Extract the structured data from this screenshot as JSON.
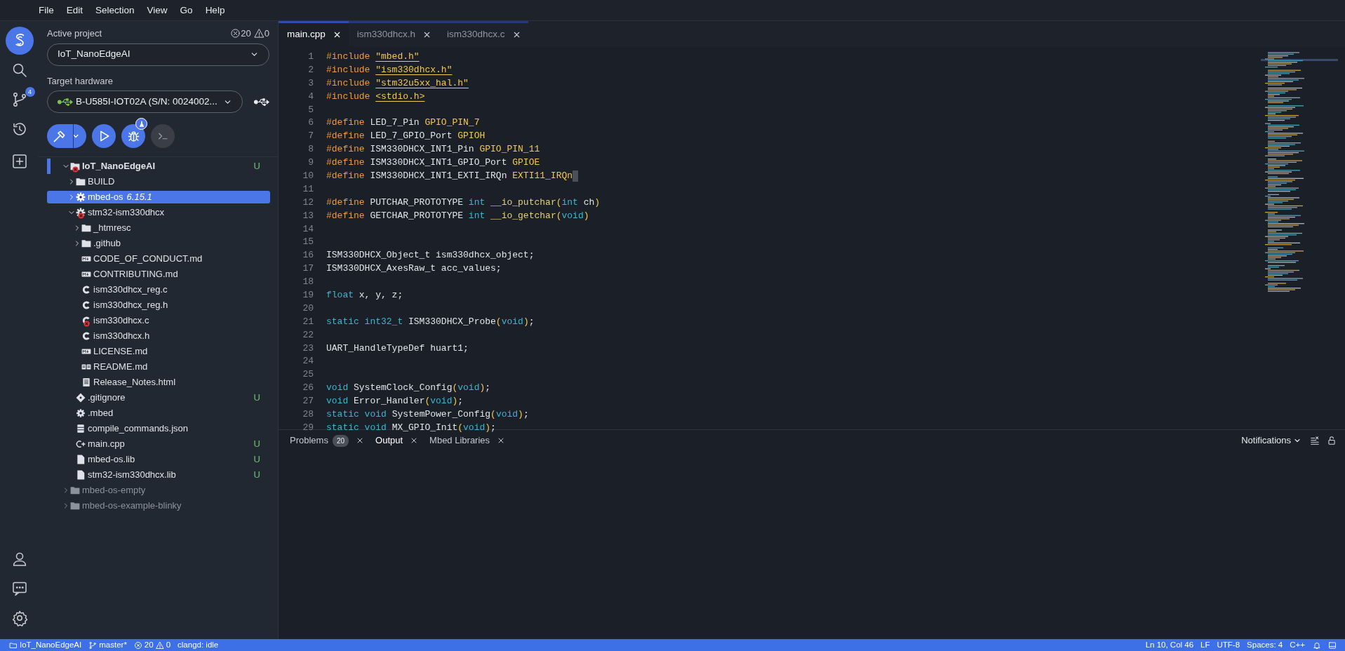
{
  "menu": [
    "File",
    "Edit",
    "Selection",
    "View",
    "Go",
    "Help"
  ],
  "activity_bar": {
    "top": [
      {
        "kind": "logo",
        "selected": true
      },
      {
        "kind": "search",
        "selected": false
      },
      {
        "kind": "source-control",
        "selected": false,
        "badge": "4"
      },
      {
        "kind": "history",
        "selected": false
      },
      {
        "kind": "add",
        "selected": false
      }
    ],
    "bottom": [
      {
        "kind": "account",
        "selected": false
      },
      {
        "kind": "feedback",
        "selected": false
      },
      {
        "kind": "settings",
        "selected": false
      }
    ]
  },
  "sidebar": {
    "project_label": "Active project",
    "errors": "20",
    "warnings": "0",
    "project": "IoT_NanoEdgeAI",
    "hardware_label": "Target hardware",
    "hardware": "B-U585I-IOT02A (S/N: 0024002...",
    "toolbar": [
      {
        "kind": "build",
        "disabled": false
      },
      {
        "kind": "run",
        "disabled": false
      },
      {
        "kind": "debug",
        "disabled": false
      },
      {
        "kind": "terminal",
        "disabled": true
      }
    ],
    "tree": [
      {
        "label": "IoT_NanoEdgeAI",
        "kind": "folder",
        "active": true,
        "expanded": true,
        "selected": false,
        "error": true,
        "status": "U",
        "children": [
          {
            "label": "BUILD",
            "kind": "folder",
            "expanded": false,
            "selected": false
          },
          {
            "label": "mbed-os",
            "version": "6.15.1",
            "kind": "library",
            "expanded": false,
            "selected": true
          },
          {
            "label": "stm32-ism330dhcx",
            "kind": "library",
            "expanded": true,
            "selected": false,
            "error": true,
            "children": [
              {
                "label": "_htmresc",
                "kind": "folder",
                "expanded": false,
                "selected": false
              },
              {
                "label": ".github",
                "kind": "folder",
                "expanded": false,
                "selected": false
              },
              {
                "label": "CODE_OF_CONDUCT.md",
                "kind": "markdown",
                "selected": false
              },
              {
                "label": "CONTRIBUTING.md",
                "kind": "markdown",
                "selected": false
              },
              {
                "label": "ism330dhcx_reg.c",
                "kind": "c",
                "selected": false
              },
              {
                "label": "ism330dhcx_reg.h",
                "kind": "c",
                "selected": false
              },
              {
                "label": "ism330dhcx.c",
                "kind": "c",
                "selected": false,
                "error": true
              },
              {
                "label": "ism330dhcx.h",
                "kind": "c",
                "selected": false
              },
              {
                "label": "LICENSE.md",
                "kind": "markdown",
                "selected": false
              },
              {
                "label": "README.md",
                "kind": "readme",
                "selected": false
              },
              {
                "label": "Release_Notes.html",
                "kind": "html",
                "selected": false
              }
            ]
          },
          {
            "label": ".gitignore",
            "kind": "git",
            "selected": false,
            "status": "U"
          },
          {
            "label": ".mbed",
            "kind": "settings",
            "selected": false
          },
          {
            "label": "compile_commands.json",
            "kind": "json",
            "selected": false
          },
          {
            "label": "main.cpp",
            "kind": "cpp",
            "selected": false,
            "status": "U"
          },
          {
            "label": "mbed-os.lib",
            "kind": "file",
            "selected": false,
            "status": "U"
          },
          {
            "label": "stm32-ism330dhcx.lib",
            "kind": "file",
            "selected": false,
            "status": "U"
          }
        ]
      },
      {
        "label": "mbed-os-empty",
        "kind": "folder",
        "active": false,
        "expanded": false,
        "selected": false
      },
      {
        "label": "mbed-os-example-blinky",
        "kind": "folder",
        "active": false,
        "expanded": false,
        "selected": false
      }
    ]
  },
  "editor": {
    "tabs": [
      {
        "label": "main.cpp",
        "selected": true
      },
      {
        "label": "ism330dhcx.h",
        "selected": false
      },
      {
        "label": "ism330dhcx.c",
        "selected": false
      }
    ],
    "lines": [
      {
        "number": "1",
        "tokens": [
          {
            "kind": "directive",
            "text": "#include "
          },
          {
            "kind": "string",
            "text": "\"mbed.h\""
          }
        ]
      },
      {
        "number": "2",
        "tokens": [
          {
            "kind": "directive",
            "text": "#include "
          },
          {
            "kind": "string",
            "text": "\"ism330dhcx.h\""
          }
        ]
      },
      {
        "number": "3",
        "tokens": [
          {
            "kind": "directive",
            "text": "#include "
          },
          {
            "kind": "string",
            "text": "\"stm32u5xx_hal.h\""
          }
        ]
      },
      {
        "number": "4",
        "tokens": [
          {
            "kind": "directive",
            "text": "#include "
          },
          {
            "kind": "string",
            "text": "<stdio.h>"
          }
        ]
      },
      {
        "number": "5"
      },
      {
        "number": "6",
        "tokens": [
          {
            "kind": "directive",
            "text": "#define"
          },
          {
            "kind": "plain",
            "text": " LED_7_Pin "
          },
          {
            "kind": "macro",
            "text": "GPIO_PIN_7"
          }
        ]
      },
      {
        "number": "7",
        "tokens": [
          {
            "kind": "directive",
            "text": "#define"
          },
          {
            "kind": "plain",
            "text": " LED_7_GPIO_Port "
          },
          {
            "kind": "macro",
            "text": "GPIOH"
          }
        ]
      },
      {
        "number": "8",
        "tokens": [
          {
            "kind": "directive",
            "text": "#define"
          },
          {
            "kind": "plain",
            "text": " ISM330DHCX_INT1_Pin "
          },
          {
            "kind": "macro",
            "text": "GPIO_PIN_11"
          }
        ]
      },
      {
        "number": "9",
        "tokens": [
          {
            "kind": "directive",
            "text": "#define"
          },
          {
            "kind": "plain",
            "text": " ISM330DHCX_INT1_GPIO_Port "
          },
          {
            "kind": "macro",
            "text": "GPIOE"
          }
        ]
      },
      {
        "number": "10",
        "cursor": true,
        "tokens": [
          {
            "kind": "directive",
            "text": "#define"
          },
          {
            "kind": "plain",
            "text": " ISM330DHCX_INT1_EXTI_IRQn "
          },
          {
            "kind": "macro",
            "text": "EXTI11_IRQn"
          }
        ]
      },
      {
        "number": "11"
      },
      {
        "number": "12",
        "tokens": [
          {
            "kind": "directive",
            "text": "#define"
          },
          {
            "kind": "plain",
            "text": " PUTCHAR_PROTOTYPE "
          },
          {
            "kind": "keyword",
            "text": "int "
          },
          {
            "kind": "function",
            "text": "__io_putchar"
          },
          {
            "kind": "macro",
            "text": "("
          },
          {
            "kind": "keyword",
            "text": "int"
          },
          {
            "kind": "plain",
            "text": " ch"
          },
          {
            "kind": "macro",
            "text": ")"
          }
        ]
      },
      {
        "number": "13",
        "tokens": [
          {
            "kind": "directive",
            "text": "#define"
          },
          {
            "kind": "plain",
            "text": " GETCHAR_PROTOTYPE "
          },
          {
            "kind": "keyword",
            "text": "int "
          },
          {
            "kind": "function",
            "text": "__io_getchar"
          },
          {
            "kind": "macro",
            "text": "("
          },
          {
            "kind": "keyword",
            "text": "void"
          },
          {
            "kind": "macro",
            "text": ")"
          }
        ]
      },
      {
        "number": "14"
      },
      {
        "number": "15"
      },
      {
        "number": "16",
        "tokens": [
          {
            "kind": "plain",
            "text": "ISM330DHCX_Object_t ism330dhcx_object;"
          }
        ]
      },
      {
        "number": "17",
        "tokens": [
          {
            "kind": "plain",
            "text": "ISM330DHCX_AxesRaw_t acc_values;"
          }
        ]
      },
      {
        "number": "18"
      },
      {
        "number": "19",
        "tokens": [
          {
            "kind": "keyword",
            "text": "float"
          },
          {
            "kind": "plain",
            "text": " x, y, z;"
          }
        ]
      },
      {
        "number": "20"
      },
      {
        "number": "21",
        "tokens": [
          {
            "kind": "keyword",
            "text": "static int32_t"
          },
          {
            "kind": "plain",
            "text": " ISM330DHCX_Probe"
          },
          {
            "kind": "macro",
            "text": "("
          },
          {
            "kind": "keyword",
            "text": "void"
          },
          {
            "kind": "macro",
            "text": ")"
          },
          {
            "kind": "plain",
            "text": ";"
          }
        ]
      },
      {
        "number": "22"
      },
      {
        "number": "23",
        "tokens": [
          {
            "kind": "plain",
            "text": "UART_HandleTypeDef huart1;"
          }
        ]
      },
      {
        "number": "24"
      },
      {
        "number": "25"
      },
      {
        "number": "26",
        "tokens": [
          {
            "kind": "keyword",
            "text": "void"
          },
          {
            "kind": "plain",
            "text": " SystemClock_Config"
          },
          {
            "kind": "macro",
            "text": "("
          },
          {
            "kind": "keyword",
            "text": "void"
          },
          {
            "kind": "macro",
            "text": ")"
          },
          {
            "kind": "plain",
            "text": ";"
          }
        ]
      },
      {
        "number": "27",
        "tokens": [
          {
            "kind": "keyword",
            "text": "void"
          },
          {
            "kind": "plain",
            "text": " Error_Handler"
          },
          {
            "kind": "macro",
            "text": "("
          },
          {
            "kind": "keyword",
            "text": "void"
          },
          {
            "kind": "macro",
            "text": ")"
          },
          {
            "kind": "plain",
            "text": ";"
          }
        ]
      },
      {
        "number": "28",
        "tokens": [
          {
            "kind": "keyword",
            "text": "static void"
          },
          {
            "kind": "plain",
            "text": " SystemPower_Config"
          },
          {
            "kind": "macro",
            "text": "("
          },
          {
            "kind": "keyword",
            "text": "void"
          },
          {
            "kind": "macro",
            "text": ")"
          },
          {
            "kind": "plain",
            "text": ";"
          }
        ]
      },
      {
        "number": "29",
        "tokens": [
          {
            "kind": "keyword",
            "text": "static void"
          },
          {
            "kind": "plain",
            "text": " MX_GPIO_Init"
          },
          {
            "kind": "macro",
            "text": "("
          },
          {
            "kind": "keyword",
            "text": "void"
          },
          {
            "kind": "macro",
            "text": ")"
          },
          {
            "kind": "plain",
            "text": ";"
          }
        ]
      }
    ]
  },
  "panel": {
    "tabs": [
      {
        "label": "Problems",
        "badge": "20",
        "selected": false
      },
      {
        "label": "Output",
        "selected": true
      },
      {
        "label": "Mbed Libraries",
        "selected": false
      }
    ],
    "channel": "Notifications"
  },
  "status_bar": {
    "left": [
      {
        "kind": "folder",
        "text": "IoT_NanoEdgeAI"
      },
      {
        "kind": "branch",
        "text": "master*"
      },
      {
        "kind": "problems",
        "errors": "20",
        "warnings": "0"
      },
      {
        "kind": "text",
        "text": "clangd: idle"
      }
    ],
    "right": [
      "Ln 10, Col 46",
      "LF",
      "UTF-8",
      "Spaces: 4",
      "C++"
    ]
  }
}
